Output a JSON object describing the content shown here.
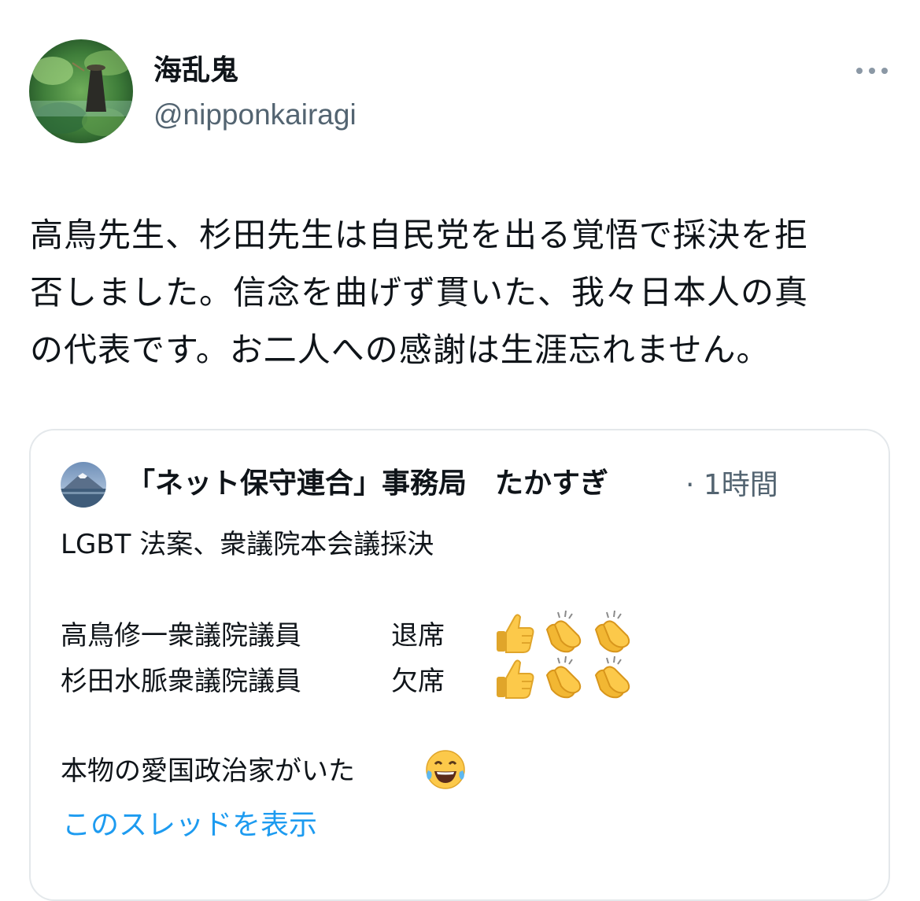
{
  "tweet": {
    "author": {
      "display_name": "海乱鬼",
      "handle": "@nipponkairagi"
    },
    "body_lines": [
      "高鳥先生、杉田先生は自民党を出る覚悟で採決を拒",
      "否しました。信念を曲げず貫いた、我々日本人の真",
      "の代表です。お二人への感謝は生涯忘れません。"
    ],
    "quoted": {
      "author_name": "「ネット保守連合」事務局　たかすぎ",
      "meta": "· 1時間",
      "lines": {
        "title": "LGBT 法案、衆議院本会議採決",
        "member1": "高鳥修一衆議院議員",
        "member1_status": "退席",
        "member2": "杉田水脈衆議院議員",
        "member2_status": "欠席",
        "closing": "本物の愛国政治家がいた"
      },
      "show_thread": "このスレッドを表示"
    }
  },
  "icons": {
    "more": "more-icon",
    "thumbs_up": "thumbs-up-icon",
    "clap": "clapping-hands-icon",
    "laugh": "tears-of-joy-icon"
  },
  "colors": {
    "text": "#0f1419",
    "secondary": "#536471",
    "link": "#1d9bf0",
    "border": "#e4e8eb"
  }
}
